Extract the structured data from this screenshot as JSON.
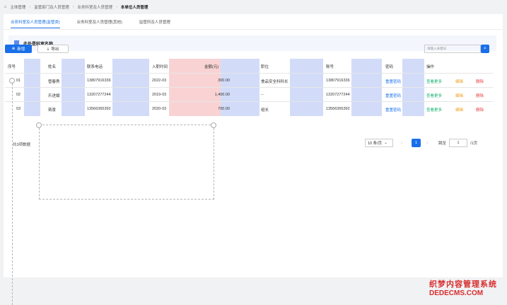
{
  "breadcrumb": {
    "home_icon": "home-icon",
    "items": [
      "主体管理",
      "监管部门及人员管理",
      "业务科室及人员管理",
      "本单位人员管理"
    ]
  },
  "tabs": [
    {
      "label": "业务科室及人员管理(监管类)",
      "active": true
    },
    {
      "label": "业务科室及人员管理(其他)",
      "active": false
    },
    {
      "label": "监管所及人员管理",
      "active": false
    }
  ],
  "section": {
    "title": "此处是科室名称",
    "icon": "department-icon"
  },
  "toolbar": {
    "add_label": "新增",
    "add_icon": "plus-circle-icon",
    "export_label": "导出",
    "export_icon": "download-icon",
    "search_placeholder": "请输入关键词",
    "search_icon": "search-icon"
  },
  "table": {
    "columns": [
      "序号",
      "姓名",
      "联系电话",
      "入职时间",
      "金额(元)",
      "职位",
      "账号",
      "密码",
      "操作"
    ],
    "rows": [
      {
        "no": "01",
        "name": "管春秀",
        "phone": "13807916336",
        "date": "2022-03",
        "amount": "300.00",
        "position": "食品安全科科长",
        "account": "13807916336",
        "password_action": "重置密码",
        "view": "查看更多",
        "edit": "编辑",
        "delete": "删除"
      },
      {
        "no": "02",
        "name": "乐进娟",
        "phone": "13207277244",
        "date": "2019-03",
        "amount": "1,400.00",
        "position": "--",
        "account": "13207277244",
        "password_action": "重置密码",
        "view": "查看更多",
        "edit": "编辑",
        "delete": "删除"
      },
      {
        "no": "03",
        "name": "蒋景",
        "phone": "13566365392",
        "date": "2020-03",
        "amount": "700.00",
        "position": "组长",
        "account": "13566365392",
        "password_action": "重置密码",
        "view": "查看更多",
        "edit": "编辑",
        "delete": "删除"
      }
    ]
  },
  "pagination": {
    "total": "共3项数据",
    "page_size": "10 条/页",
    "current_page": "1",
    "jump_label": "跳至",
    "jump_value": "1",
    "jump_suffix": "/1页"
  },
  "watermark": {
    "line1": "织梦内容管理系统",
    "line2": "DEDECMS.COM"
  },
  "colors": {
    "accent": "#1a6fe8",
    "highlight_blue": "#d2dcf9",
    "highlight_red": "#f9d3d3",
    "view": "#16b070",
    "edit": "#f0a020",
    "delete": "#e84040"
  }
}
